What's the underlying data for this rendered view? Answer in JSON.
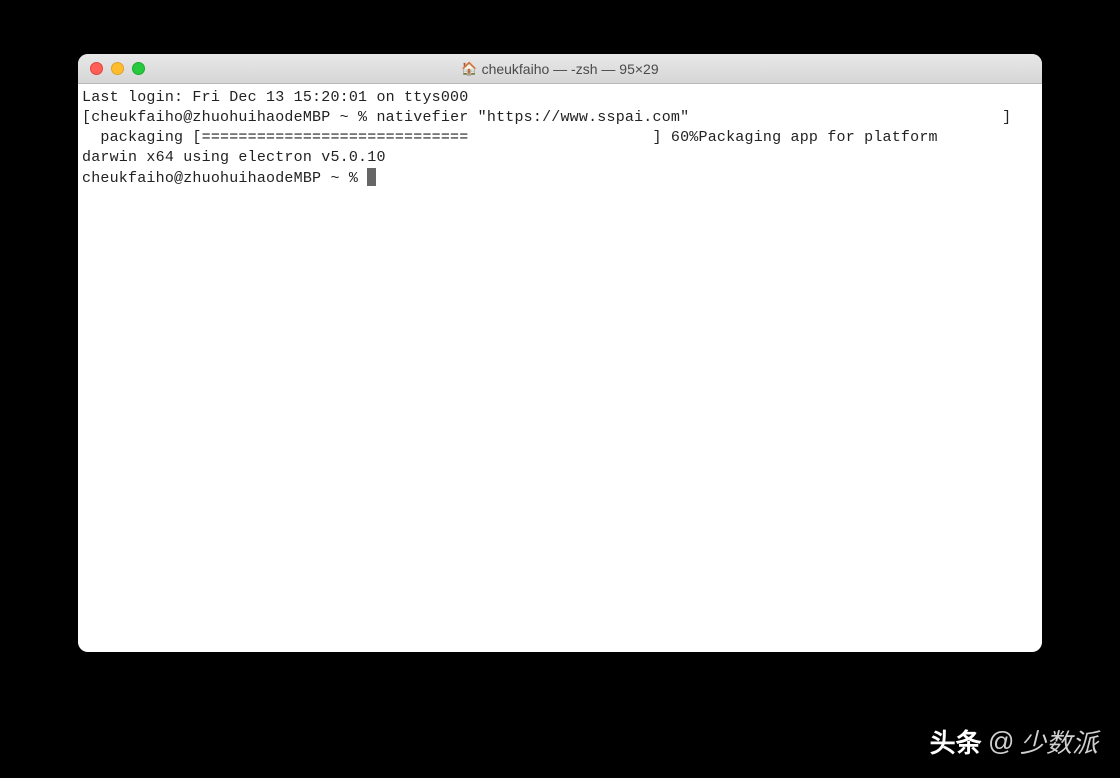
{
  "window": {
    "title": "cheukfaiho — -zsh — 95×29"
  },
  "terminal": {
    "line1": "Last login: Fri Dec 13 15:20:01 on ttys000",
    "line2_prefix": "[",
    "line2_prompt": "cheukfaiho@zhuohuihaodeMBP ~ % ",
    "line2_command": "nativefier \"https://www.sspai.com\"",
    "line2_suffix": "                                  ]",
    "line3": "  packaging [=============================                    ] 60%Packaging app for platform",
    "line4": "darwin x64 using electron v5.0.10",
    "line5_prompt": "cheukfaiho@zhuohuihaodeMBP ~ % "
  },
  "watermark": {
    "brand": "头条",
    "at": "@",
    "name": "少数派"
  }
}
